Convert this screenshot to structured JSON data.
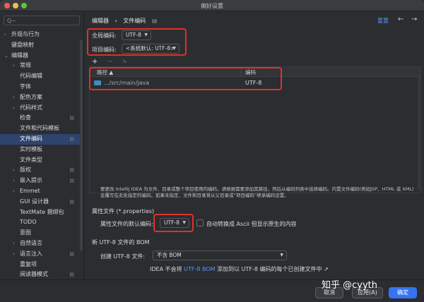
{
  "window": {
    "title": "偏好设置"
  },
  "search": {
    "placeholder": "Q~"
  },
  "sidebar": {
    "items": [
      {
        "label": "外观与行为",
        "chevron": "›",
        "level": 0
      },
      {
        "label": "键盘映射",
        "chevron": "",
        "level": 0
      },
      {
        "label": "编辑器",
        "chevron": "⌄",
        "level": 0
      },
      {
        "label": "常规",
        "chevron": "›",
        "level": 1
      },
      {
        "label": "代码编辑",
        "chevron": "",
        "level": 1
      },
      {
        "label": "字体",
        "chevron": "",
        "level": 1
      },
      {
        "label": "配色方案",
        "chevron": "›",
        "level": 1
      },
      {
        "label": "代码样式",
        "chevron": "›",
        "level": 1
      },
      {
        "label": "检查",
        "chevron": "",
        "level": 1,
        "mark": "▤"
      },
      {
        "label": "文件和代码模板",
        "chevron": "",
        "level": 1
      },
      {
        "label": "文件编码",
        "chevron": "",
        "level": 1,
        "mark": "▤",
        "selected": true
      },
      {
        "label": "实时模板",
        "chevron": "",
        "level": 1
      },
      {
        "label": "文件类型",
        "chevron": "",
        "level": 1
      },
      {
        "label": "版权",
        "chevron": "›",
        "level": 1,
        "mark": "▤"
      },
      {
        "label": "嵌入提示",
        "chevron": "›",
        "level": 1,
        "mark": "▤"
      },
      {
        "label": "Emmet",
        "chevron": "›",
        "level": 1
      },
      {
        "label": "GUI 设计器",
        "chevron": "",
        "level": 1,
        "mark": "▤"
      },
      {
        "label": "TextMate 捆绑包",
        "chevron": "",
        "level": 1
      },
      {
        "label": "TODO",
        "chevron": "",
        "level": 1
      },
      {
        "label": "意图",
        "chevron": "",
        "level": 1
      },
      {
        "label": "自然语言",
        "chevron": "›",
        "level": 1
      },
      {
        "label": "语言注入",
        "chevron": "›",
        "level": 1,
        "mark": "▤"
      },
      {
        "label": "重复项",
        "chevron": "",
        "level": 1
      },
      {
        "label": "阅读器模式",
        "chevron": "",
        "level": 1,
        "mark": "▤"
      }
    ]
  },
  "breadcrumb": {
    "parent": "编辑器",
    "sep": "›",
    "current": "文件编码",
    "icon": "▤"
  },
  "header": {
    "reset": "重置",
    "back": "←",
    "forward": "→"
  },
  "global_encoding": {
    "label": "全局编码:",
    "value": "UTF-8"
  },
  "project_encoding": {
    "label": "项目编码:",
    "value": "<系统默认: UTF-8>"
  },
  "table_toolbar": {
    "add": "+",
    "remove": "−",
    "edit": "✎"
  },
  "table": {
    "col_path": "路径 ▲",
    "col_encoding": "编码",
    "rows": [
      {
        "path": ".../src/main/java",
        "encoding": "UTF-8"
      }
    ]
  },
  "note": {
    "text": "要更改 IntelliJ IDEA 为文件、目录或整个项目使用的编码，请根据需要添加其路径，然后从编码列表中选择编码。内置文件编码(例如JSP、HTML 或 XML)会覆写在此处指定的编码。如果未指定，文件和目录将从父目录或“项目编码”继承编码设置。"
  },
  "properties": {
    "section": "属性文件 (*.properties)",
    "default_label": "属性文件的默认编码:",
    "default_value": "UTF-8",
    "native_label": "自动转换成 Ascii 但显示原生的内容"
  },
  "bom": {
    "section": "新 UTF-8 文件的 BOM",
    "create_label": "创建 UTF-8 文件:",
    "create_value": "不含 BOM",
    "info_prefix": "IDEA 不会将",
    "info_link": "UTF-8 BOM",
    "info_suffix": "添加到以 UTF-8 编码的每个已创建文件中 ↗"
  },
  "footer": {
    "help": "?",
    "cancel": "取消",
    "apply": "应用(A)",
    "ok": "确定",
    "watermark": "知乎 @cyyth"
  },
  "colors": {
    "accent": "#3574f0",
    "highlight": "#e0302c",
    "selection": "#2e436e"
  }
}
